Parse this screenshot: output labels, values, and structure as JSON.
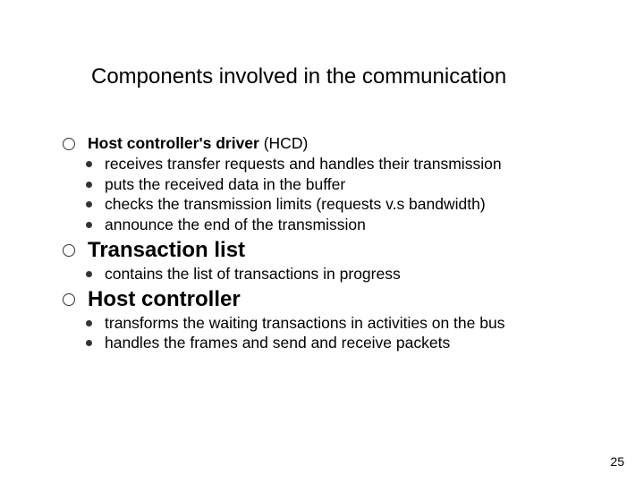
{
  "title": "Components involved in the communication",
  "items": [
    {
      "head_bold": "Host controller's driver",
      "head_rest": " (HCD)",
      "big": false,
      "subs": [
        "receives transfer requests and handles their transmission",
        "puts the received data in the buffer",
        "checks the transmission limits (requests v.s bandwidth)",
        "announce the end of the transmission"
      ]
    },
    {
      "head_bold": "Transaction list",
      "head_rest": "",
      "big": true,
      "subs": [
        "contains the list of transactions in progress"
      ]
    },
    {
      "head_bold": "Host controller",
      "head_rest": "",
      "big": true,
      "subs": [
        "transforms the waiting transactions in activities on the bus",
        "handles the frames and send and receive packets"
      ]
    }
  ],
  "page": "25"
}
